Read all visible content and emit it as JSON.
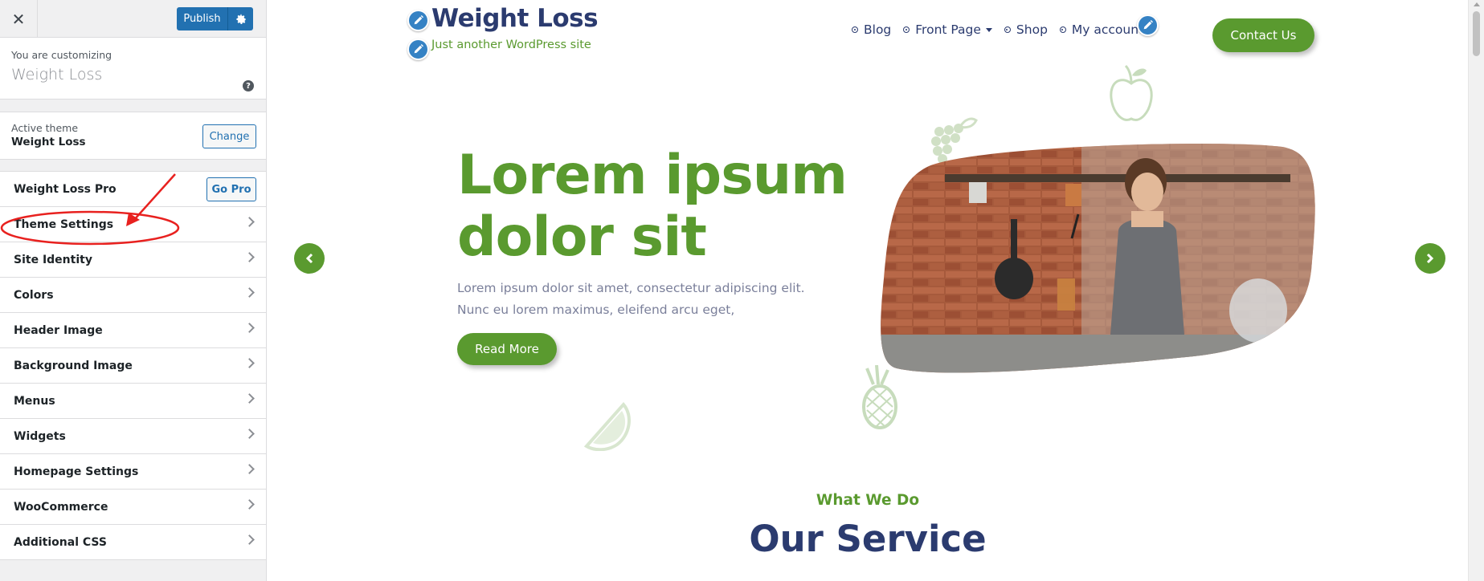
{
  "customizer": {
    "close_label": "✕",
    "publish_label": "Publish",
    "customizing_label": "You are customizing",
    "site_name": "Weight Loss",
    "help_label": "?",
    "active_theme_label": "Active theme",
    "active_theme_name": "Weight Loss",
    "change_label": "Change",
    "pro_label": "Weight Loss Pro",
    "go_pro_label": "Go Pro",
    "sections": [
      "Theme Settings",
      "Site Identity",
      "Colors",
      "Header Image",
      "Background Image",
      "Menus",
      "Widgets",
      "Homepage Settings",
      "WooCommerce",
      "Additional CSS"
    ],
    "annotation_color": "#e8211f"
  },
  "site": {
    "title": "Weight Loss",
    "tagline": "Just another WordPress site",
    "nav": [
      {
        "label": "Blog"
      },
      {
        "label": "Front Page",
        "has_dropdown": true
      },
      {
        "label": "Shop"
      },
      {
        "label": "My account"
      }
    ],
    "contact_label": "Contact Us",
    "hero": {
      "title_line1": "Lorem ipsum",
      "title_line2": "dolor sit",
      "text_line1": "Lorem ipsum dolor sit amet, consectetur adipiscing elit.",
      "text_line2": "Nunc eu lorem maximus, eleifend arcu eget,",
      "cta_label": "Read More"
    },
    "section_kicker": "What We Do",
    "section_title": "Our Service",
    "colors": {
      "primary_green": "#5a9a2f",
      "navy": "#2b3b6f",
      "wp_blue": "#2271b1"
    }
  }
}
